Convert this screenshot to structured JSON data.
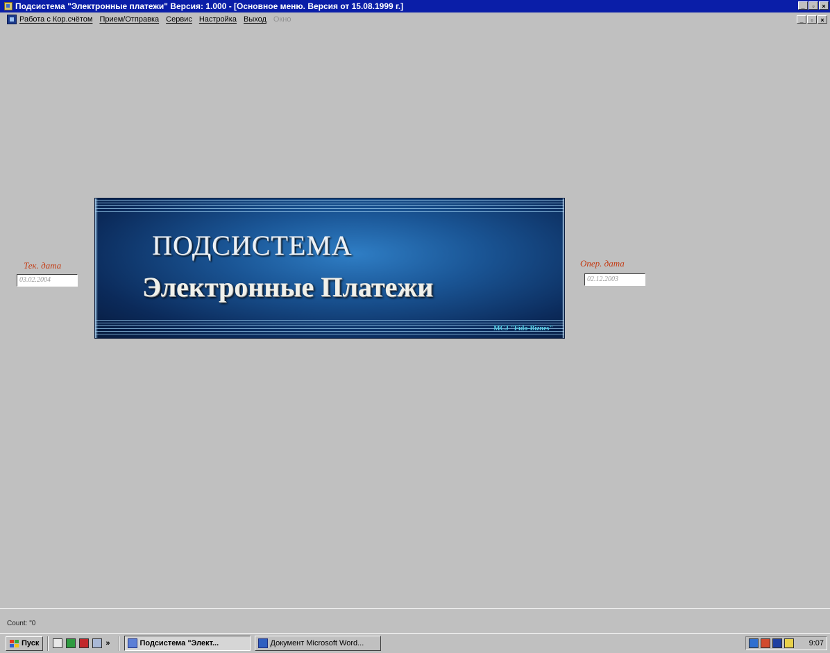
{
  "window": {
    "title": "Подсистема \"Электронные платежи\"    Версия: 1.000 - [Основное меню. Версия от 15.08.1999 г.]"
  },
  "menu": {
    "items": [
      "Работа с Кор.счётом",
      "Прием/Отправка",
      "Сервис",
      "Настройка",
      "Выход",
      "Окно"
    ]
  },
  "banner": {
    "line1": "ПОДСИСТЕМА",
    "line2": "Электронные Платежи",
    "credit": "MCJ \"Fido-Biznes\""
  },
  "current_date": {
    "label": "Тек. дата",
    "value": "03.02.2004"
  },
  "oper_date": {
    "label": "Опер. дата",
    "value": "02.12.2003"
  },
  "status": {
    "text": "Count: \"0"
  },
  "taskbar": {
    "start_label": "Пуск",
    "tasks": [
      "Подсистема \"Элект...",
      "Документ Microsoft Word..."
    ],
    "clock": "9:07"
  },
  "colors": {
    "title_bar": "#0a1ea8",
    "desktop": "#c0c0c0",
    "date_label": "#c33a12",
    "banner_credit": "#59d2e8"
  },
  "icons": [
    "app-icon",
    "document-icon",
    "windows-logo-icon",
    "quicklaunch-icon",
    "task-icon",
    "tray-icon"
  ]
}
